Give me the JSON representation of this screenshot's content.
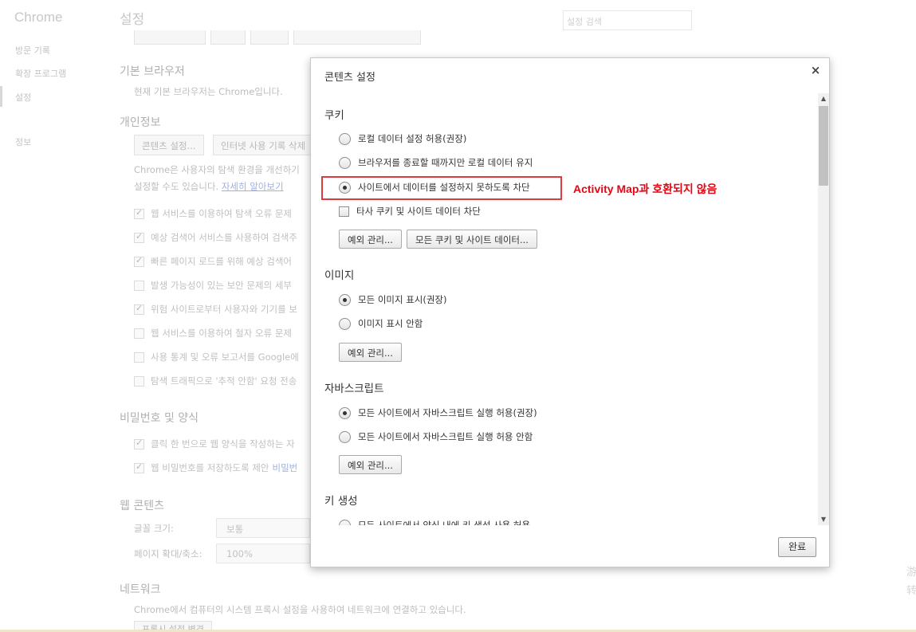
{
  "app": {
    "brand": "Chrome"
  },
  "sidebar": {
    "items": [
      {
        "label": "방문 기록"
      },
      {
        "label": "확장 프로그램"
      },
      {
        "label": "설정"
      },
      {
        "label": "정보"
      }
    ]
  },
  "page": {
    "title": "설정",
    "search_placeholder": "설정 검색"
  },
  "background": {
    "default_browser": {
      "heading": "기본 브라우저",
      "text": "현재 기본 브라우저는 Chrome입니다."
    },
    "privacy": {
      "heading": "개인정보",
      "content_settings_btn": "콘텐츠 설정...",
      "clear_history_btn": "인터넷 사용 기록 삭제",
      "desc_line1": "Chrome은 사용자의 탐색 환경을 개선하기",
      "desc_line2": "설정할 수도 있습니다.",
      "learn_more": "자세히 알아보기",
      "checkboxes": [
        {
          "label": "웹 서비스를 이용하여 탐색 오류 문제",
          "checked": true
        },
        {
          "label": "예상 검색어 서비스를 사용하여 검색주",
          "checked": true
        },
        {
          "label": "빠른 페이지 로드를 위해 예상 검색어",
          "checked": true
        },
        {
          "label": "발생 가능성이 있는 보안 문제의 세부",
          "checked": false
        },
        {
          "label": "위험 사이트로부터 사용자와 기기를 보",
          "checked": true
        },
        {
          "label": "웹 서비스를 이용하여 철자 오류 문제",
          "checked": false
        },
        {
          "label": "사용 통계 및 오류 보고서를 Google에",
          "checked": false
        },
        {
          "label": "탐색 트래픽으로 '추적 안함' 요청 전송",
          "checked": false
        }
      ]
    },
    "passwords": {
      "heading": "비밀번호 및 양식",
      "checkboxes": [
        {
          "label": "클릭 한 번으로 웹 양식을 작성하는 자",
          "checked": true
        },
        {
          "label": "웹 비밀번호를 저장하도록 제안",
          "link": "비밀번",
          "checked": true
        }
      ]
    },
    "web_content": {
      "heading": "웹 콘텐츠",
      "font_size_label": "글꼴 크기:",
      "font_size_value": "보통",
      "zoom_label": "페이지 확대/축소:",
      "zoom_value": "100%"
    },
    "network": {
      "heading": "네트워크",
      "text": "Chrome에서 컴퓨터의 시스템 프록시 설정을 사용하여 네트워크에 연결하고 있습니다.",
      "button": "프록시 설정 변경"
    },
    "right_edge_chars": [
      "游",
      "转"
    ]
  },
  "dialog": {
    "title": "콘텐츠 설정",
    "close": "×",
    "done_button": "완료",
    "annotation": "Activity Map과 호환되지 않음",
    "cookies": {
      "heading": "쿠키",
      "options": [
        {
          "label": "로컬 데이터 설정 허용(권장)",
          "selected": false
        },
        {
          "label": "브라우저를 종료할 때까지만 로컬 데이터 유지",
          "selected": false
        },
        {
          "label": "사이트에서 데이터를 설정하지 못하도록 차단",
          "selected": true
        }
      ],
      "third_party": {
        "label": "타사 쿠키 및 사이트 데이터 차단",
        "checked": false
      },
      "exceptions_btn": "예외 관리...",
      "all_cookies_btn": "모든 쿠키 및 사이트 데이터..."
    },
    "images": {
      "heading": "이미지",
      "options": [
        {
          "label": "모든 이미지 표시(권장)",
          "selected": true
        },
        {
          "label": "이미지 표시 안함",
          "selected": false
        }
      ],
      "exceptions_btn": "예외 관리..."
    },
    "javascript": {
      "heading": "자바스크립트",
      "options": [
        {
          "label": "모든 사이트에서 자바스크립트 실행 허용(권장)",
          "selected": true
        },
        {
          "label": "모든 사이트에서 자바스크립트 실행 허용 안함",
          "selected": false
        }
      ],
      "exceptions_btn": "예외 관리..."
    },
    "keygen": {
      "heading": "키 생성",
      "options": [
        {
          "label": "모든 사이트에서 양식 내에 키 생성 사용 허용",
          "selected": false
        }
      ]
    }
  }
}
